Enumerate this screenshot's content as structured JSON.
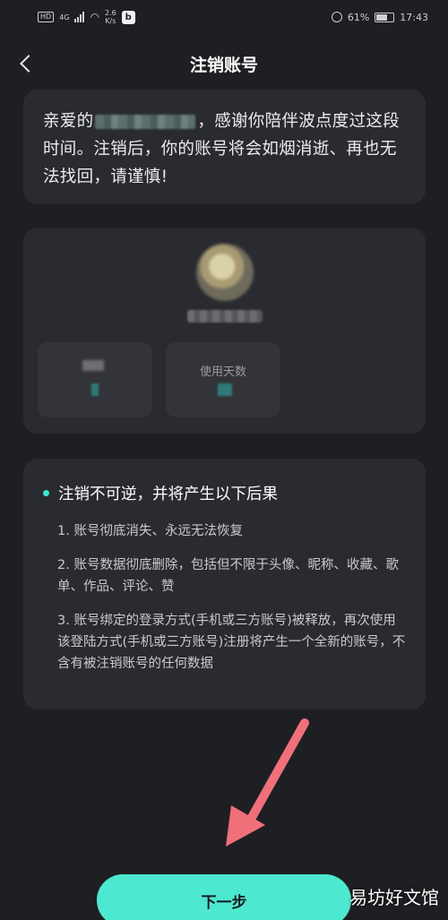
{
  "status_bar": {
    "network": "4G",
    "speed_value": "2.6",
    "speed_unit": "K/s",
    "app_badge": "b",
    "battery": "61%",
    "time": "17:43"
  },
  "header": {
    "title": "注销账号",
    "back_icon": "chevron-left-icon"
  },
  "intro": {
    "prefix": "亲爱的",
    "suffix": "，感谢你陪伴波点度过这段时间。注销后，你的账号将会如烟消逝、再也无法找回，请谨慎!"
  },
  "profile": {
    "stat_right_label": "使用天数"
  },
  "warning": {
    "heading": "注销不可逆，并将产生以下后果",
    "items": [
      "1. 账号彻底消失、永远无法恢复",
      "2. 账号数据彻底删除，包括但不限于头像、昵称、收藏、歌单、作品、评论、赞",
      "3. 账号绑定的登录方式(手机或三方账号)被释放，再次使用该登陆方式(手机或三方账号)注册将产生一个全新的账号，不含有被注销账号的任何数据"
    ]
  },
  "actions": {
    "next_label": "下一步"
  },
  "watermark": "易坊好文馆",
  "colors": {
    "accent": "#4de8d0",
    "background": "#1e1f23",
    "card": "#2a2b30",
    "arrow": "#f0707a"
  }
}
